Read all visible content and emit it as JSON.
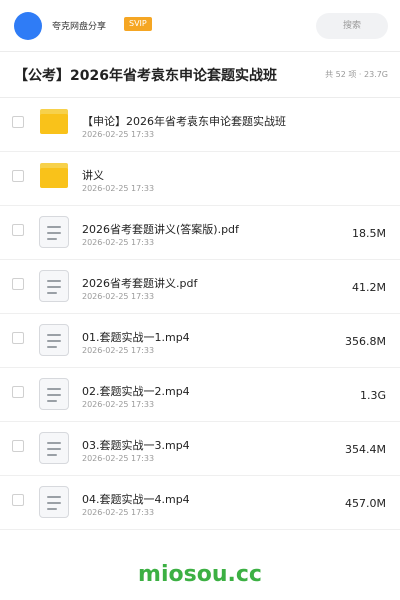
{
  "header": {
    "username": "夸克网盘分享",
    "badge": "SVIP",
    "search_placeholder": "搜索"
  },
  "folder": {
    "title": "【公考】2026年省考袁东申论套题实战班",
    "meta": "共 52 项 · 23.7G"
  },
  "files": [
    {
      "type": "folder",
      "name": "【申论】2026年省考袁东申论套题实战班",
      "date": "2026-02-25 17:33",
      "size": ""
    },
    {
      "type": "folder",
      "name": "讲义",
      "date": "2026-02-25 17:33",
      "size": ""
    },
    {
      "type": "file",
      "name": "2026省考套题讲义(答案版).pdf",
      "date": "2026-02-25 17:33",
      "size": "18.5M"
    },
    {
      "type": "file",
      "name": "2026省考套题讲义.pdf",
      "date": "2026-02-25 17:33",
      "size": "41.2M"
    },
    {
      "type": "file",
      "name": "01.套题实战一1.mp4",
      "date": "2026-02-25 17:33",
      "size": "356.8M"
    },
    {
      "type": "file",
      "name": "02.套题实战一2.mp4",
      "date": "2026-02-25 17:33",
      "size": "1.3G"
    },
    {
      "type": "file",
      "name": "03.套题实战一3.mp4",
      "date": "2026-02-25 17:33",
      "size": "354.4M"
    },
    {
      "type": "file",
      "name": "04.套题实战一4.mp4",
      "date": "2026-02-25 17:33",
      "size": "457.0M"
    }
  ],
  "watermark": "miosou.cc",
  "colors": {
    "avatar": "#2f7cf6",
    "badge": "#f5a623",
    "folder": "#f9c21a",
    "watermark": "#3cb043"
  }
}
